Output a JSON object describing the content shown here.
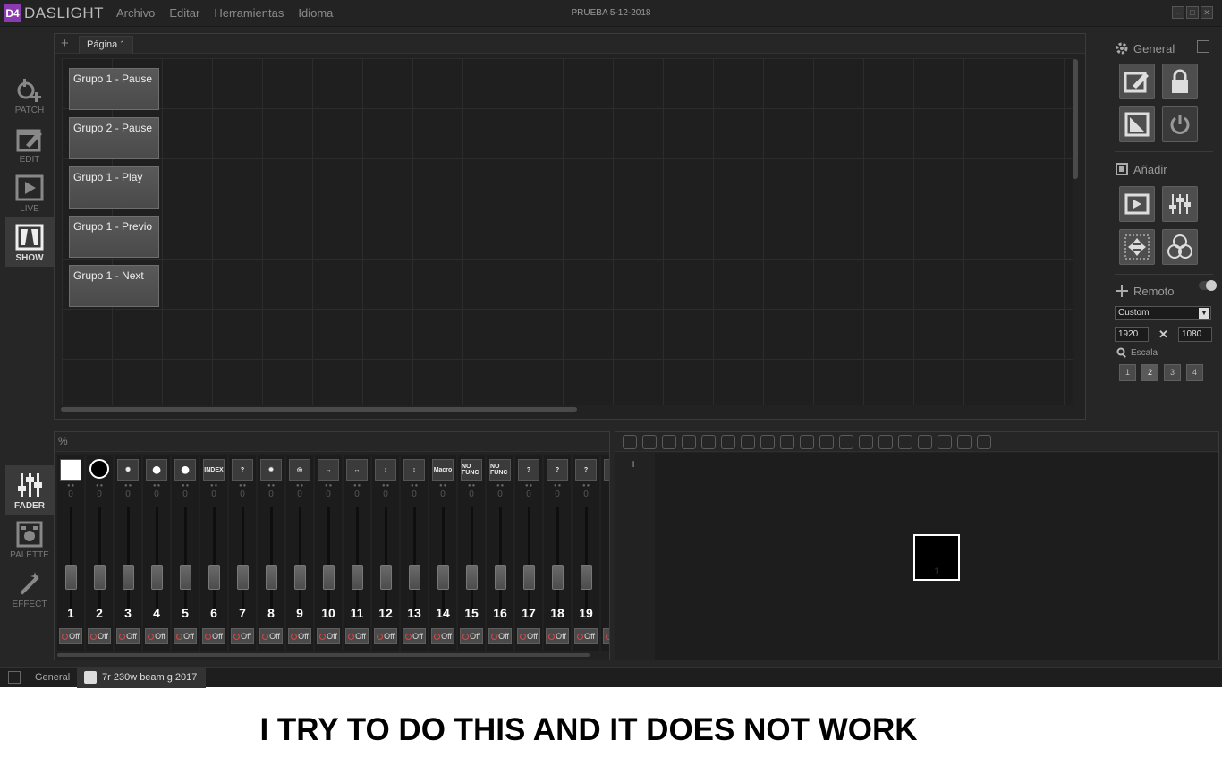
{
  "app": {
    "logo_mark": "D4",
    "logo_text": "DASLIGHT",
    "window_title": "PRUEBA 5-12-2018"
  },
  "menu": [
    "Archivo",
    "Editar",
    "Herramientas",
    "Idioma"
  ],
  "sidebar_top": [
    {
      "label": "PATCH",
      "icon": "patch-icon"
    },
    {
      "label": "EDIT",
      "icon": "edit-icon"
    },
    {
      "label": "LIVE",
      "icon": "live-play-icon"
    },
    {
      "label": "SHOW",
      "icon": "show-stage-icon",
      "active": true
    }
  ],
  "sidebar_bottom": [
    {
      "label": "FADER",
      "icon": "fader-icon",
      "active": true
    },
    {
      "label": "PALETTE",
      "icon": "palette-icon"
    },
    {
      "label": "EFFECT",
      "icon": "magic-wand-icon"
    }
  ],
  "show": {
    "add_label": "+",
    "page_tab": "Página 1",
    "buttons": [
      "Grupo 1 - Pause",
      "Grupo 2 - Pause",
      "Grupo 1 - Play",
      "Grupo 1 - Previo",
      "Grupo 1 - Next"
    ]
  },
  "right_panel": {
    "general_label": "General",
    "add_label": "Añadir",
    "remote_label": "Remoto",
    "preset": "Custom",
    "width": "1920",
    "height": "1080",
    "times": "✕",
    "scale_label": "Escala",
    "scales": [
      "1",
      "2",
      "3",
      "4"
    ]
  },
  "fader": {
    "header": "%",
    "zero": "0",
    "off": "Off",
    "channels": [
      {
        "n": "1",
        "icon": "",
        "knob": 0
      },
      {
        "n": "2",
        "icon": "",
        "knob": 0
      },
      {
        "n": "3",
        "icon": "✺",
        "knob": 0
      },
      {
        "n": "4",
        "icon": "●",
        "knob": 0
      },
      {
        "n": "5",
        "icon": "●",
        "knob": 0
      },
      {
        "n": "6",
        "icon": "INDEX",
        "knob": 0
      },
      {
        "n": "7",
        "icon": "?",
        "knob": 0
      },
      {
        "n": "8",
        "icon": "✹",
        "knob": 0
      },
      {
        "n": "9",
        "icon": "◎",
        "knob": 0
      },
      {
        "n": "10",
        "icon": "↔",
        "knob": 0
      },
      {
        "n": "11",
        "icon": "↔",
        "knob": 0
      },
      {
        "n": "12",
        "icon": "↕",
        "knob": 0
      },
      {
        "n": "13",
        "icon": "↕",
        "knob": 0
      },
      {
        "n": "14",
        "icon": "Macro",
        "knob": 0
      },
      {
        "n": "15",
        "icon": "NO FUNC",
        "knob": 0
      },
      {
        "n": "16",
        "icon": "NO FUNC",
        "knob": 0
      },
      {
        "n": "17",
        "icon": "?",
        "knob": 0
      },
      {
        "n": "18",
        "icon": "?",
        "knob": 0
      },
      {
        "n": "19",
        "icon": "?",
        "knob": 0
      },
      {
        "n": "2",
        "icon": "",
        "knob": 0
      }
    ]
  },
  "visualizer": {
    "add_label": "+",
    "fixture_number": "1"
  },
  "status": {
    "general": "General",
    "fixture": "7r 230w beam g 2017"
  },
  "caption": "I TRY TO DO THIS AND IT DOES NOT WORK"
}
